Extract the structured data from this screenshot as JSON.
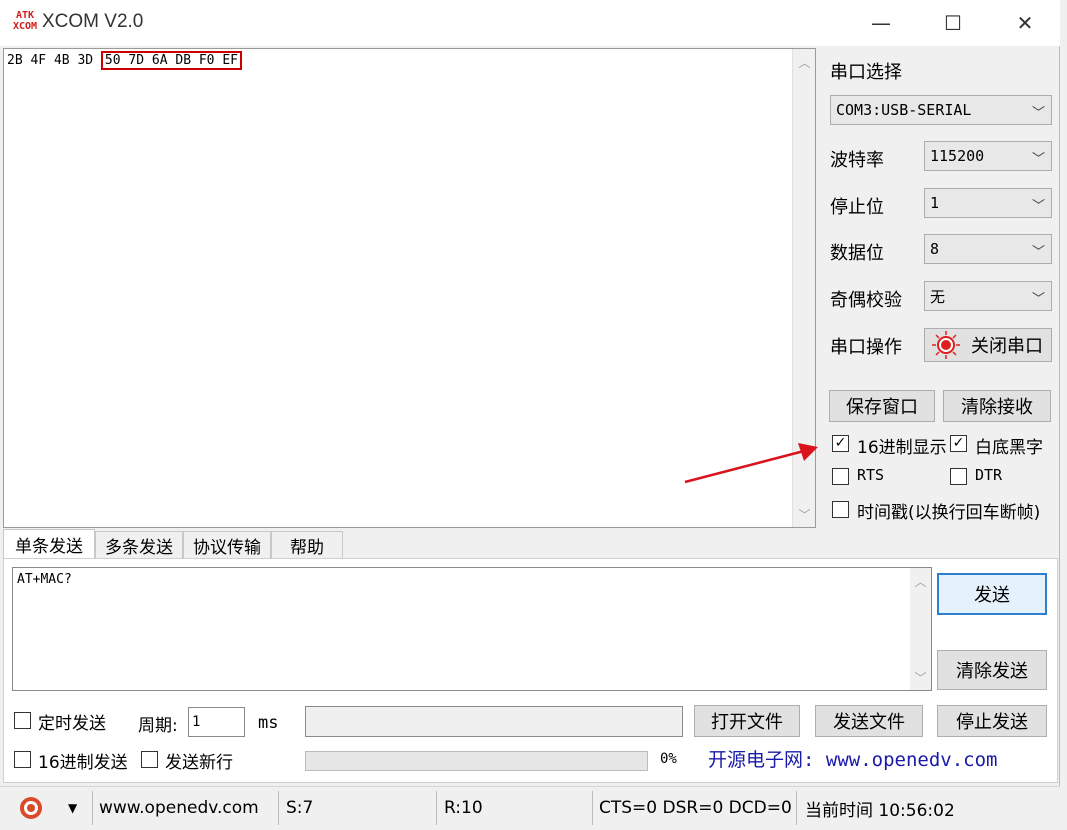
{
  "window": {
    "logo_top": "ATK",
    "logo_bottom": "XCOM",
    "title": "XCOM V2.0",
    "minimize": "—",
    "maximize": "☐",
    "close": "✕"
  },
  "receive": {
    "prefix": "2B 4F 4B 3D ",
    "highlighted": "50 7D 6A DB F0 EF"
  },
  "port_settings": {
    "section_label": "串口选择",
    "port_value": "COM3:USB-SERIAL",
    "baud_label": "波特率",
    "baud_value": "115200",
    "stopbits_label": "停止位",
    "stopbits_value": "1",
    "databits_label": "数据位",
    "databits_value": "8",
    "parity_label": "奇偶校验",
    "parity_value": "无",
    "operation_label": "串口操作",
    "close_port_label": "关闭串口"
  },
  "receive_controls": {
    "save_window": "保存窗口",
    "clear_receive": "清除接收",
    "hex_display": "16进制显示",
    "hex_display_checked": true,
    "white_bg_black_text": "白底黑字",
    "white_bg_checked": true,
    "rts": "RTS",
    "dtr": "DTR",
    "timestamp": "时间戳(以换行回车断帧)"
  },
  "tabs": [
    {
      "label": "单条发送",
      "active": true
    },
    {
      "label": "多条发送",
      "active": false
    },
    {
      "label": "协议传输",
      "active": false
    },
    {
      "label": "帮助",
      "active": false
    }
  ],
  "send": {
    "text": "AT+MAC?",
    "send_button": "发送",
    "clear_send_button": "清除发送",
    "timed_send": "定时发送",
    "period_label": "周期:",
    "period_value": "1",
    "period_unit": "ms",
    "hex_send": "16进制发送",
    "send_newline": "发送新行",
    "open_file": "打开文件",
    "send_file": "发送文件",
    "stop_send": "停止发送",
    "progress_percent": "0%",
    "banner": "开源电子网: www.openedv.com"
  },
  "status": {
    "website": "www.openedv.com",
    "sent": "S:7",
    "received": "R:10",
    "lines": "CTS=0 DSR=0 DCD=0",
    "time": "当前时间 10:56:02"
  },
  "colors": {
    "highlight_box": "#cc0000",
    "annotation_arrow": "#d9141c",
    "banner_text": "#1a1aa8",
    "primary_button_border": "#2f7fd1"
  }
}
